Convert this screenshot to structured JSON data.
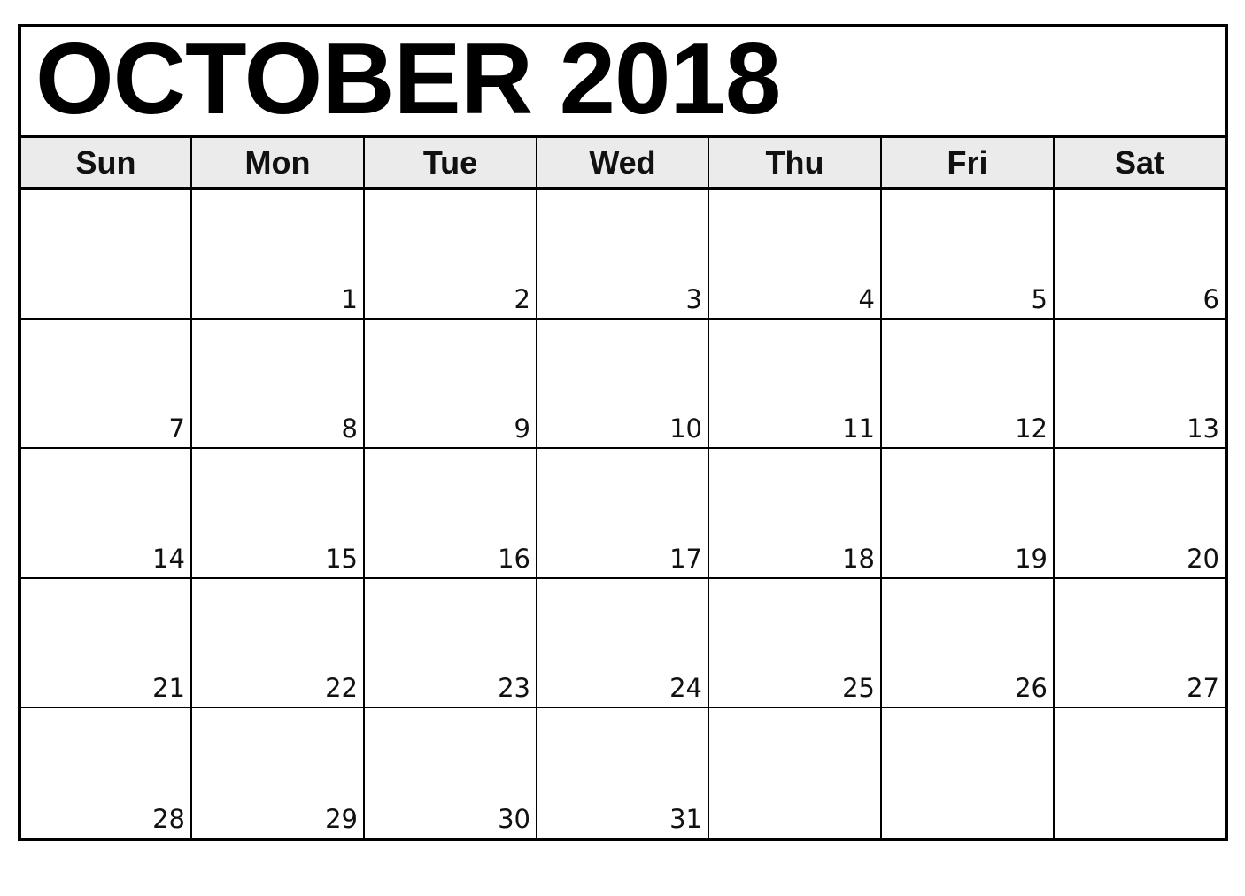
{
  "calendar": {
    "title": "OCTOBER 2018",
    "month": "October",
    "year": 2018,
    "weekdays": [
      "Sun",
      "Mon",
      "Tue",
      "Wed",
      "Thu",
      "Fri",
      "Sat"
    ],
    "weeks": [
      [
        "",
        "1",
        "2",
        "3",
        "4",
        "5",
        "6"
      ],
      [
        "7",
        "8",
        "9",
        "10",
        "11",
        "12",
        "13"
      ],
      [
        "14",
        "15",
        "16",
        "17",
        "18",
        "19",
        "20"
      ],
      [
        "21",
        "22",
        "23",
        "24",
        "25",
        "26",
        "27"
      ],
      [
        "28",
        "29",
        "30",
        "31",
        "",
        "",
        ""
      ]
    ],
    "colors": {
      "border": "#000000",
      "header_bg": "#ebebeb",
      "text": "#111111",
      "background": "#ffffff"
    }
  }
}
